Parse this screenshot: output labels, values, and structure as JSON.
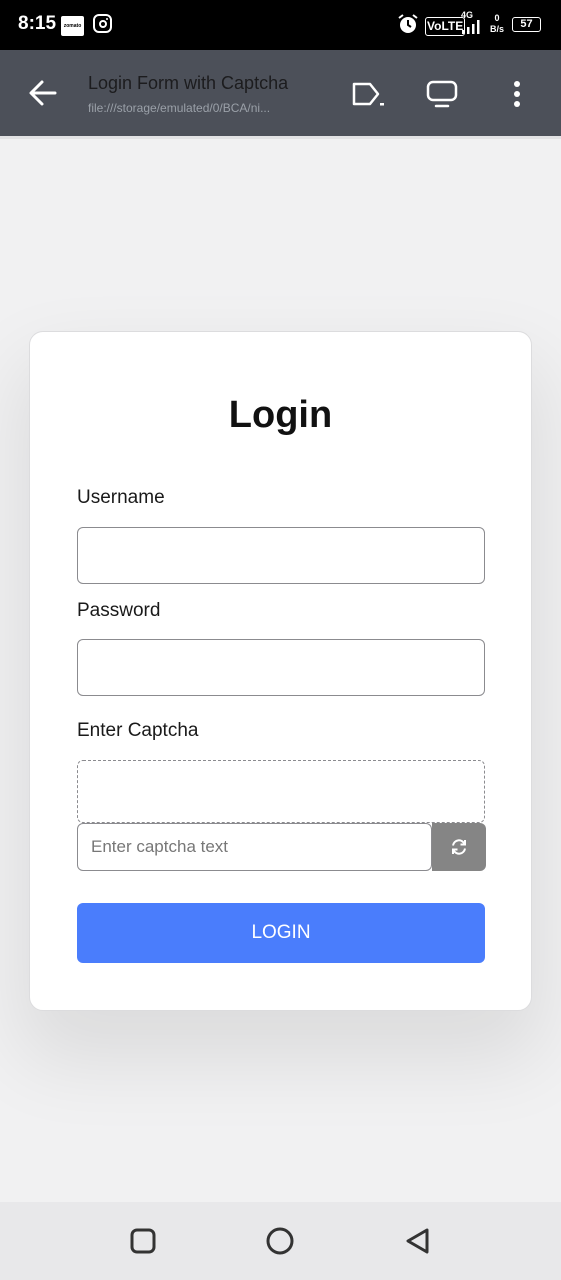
{
  "status_bar": {
    "time": "8:15",
    "zomato_label": "zomato",
    "volte": "VoLTE",
    "network_type": "4G",
    "net_speed_value": "0",
    "net_speed_unit": "B/s",
    "battery": "57"
  },
  "app_bar": {
    "title": "Login Form with Captcha",
    "url": "file:///storage/emulated/0/BCA/ni..."
  },
  "form": {
    "title": "Login",
    "username_label": "Username",
    "password_label": "Password",
    "captcha_label": "Enter Captcha",
    "captcha_placeholder": "Enter captcha text",
    "login_button": "LOGIN"
  },
  "colors": {
    "primary_button": "#4a7dfc",
    "refresh_button": "#858585",
    "app_bar": "#4c5059"
  }
}
